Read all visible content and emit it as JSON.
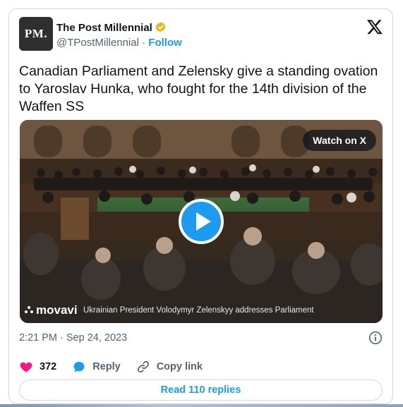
{
  "author": {
    "avatar_text": "PM.",
    "display_name": "The Post Millennial",
    "handle": "@TPostMillennial",
    "separator": "·",
    "follow_label": "Follow",
    "verified_color": "#e2b719"
  },
  "tweet": {
    "text": "Canadian Parliament and Zelensky give a standing ovation to Yaroslav Hunka, who fought for the 14th division of the Waffen SS"
  },
  "media": {
    "watch_label": "Watch on X",
    "watermark": "movavi",
    "caption": "Ukrainian President Volodymyr Zelenskyy addresses Parliament",
    "play_icon": "play-icon"
  },
  "meta": {
    "timestamp": "2:21 PM · Sep 24, 2023"
  },
  "actions": {
    "likes_count": "372",
    "reply_label": "Reply",
    "copy_link_label": "Copy link"
  },
  "footer": {
    "read_replies_label": "Read 110 replies"
  },
  "colors": {
    "accent": "#1d9bf0",
    "like": "#f91880",
    "text": "#0f1419",
    "muted": "#536471"
  }
}
